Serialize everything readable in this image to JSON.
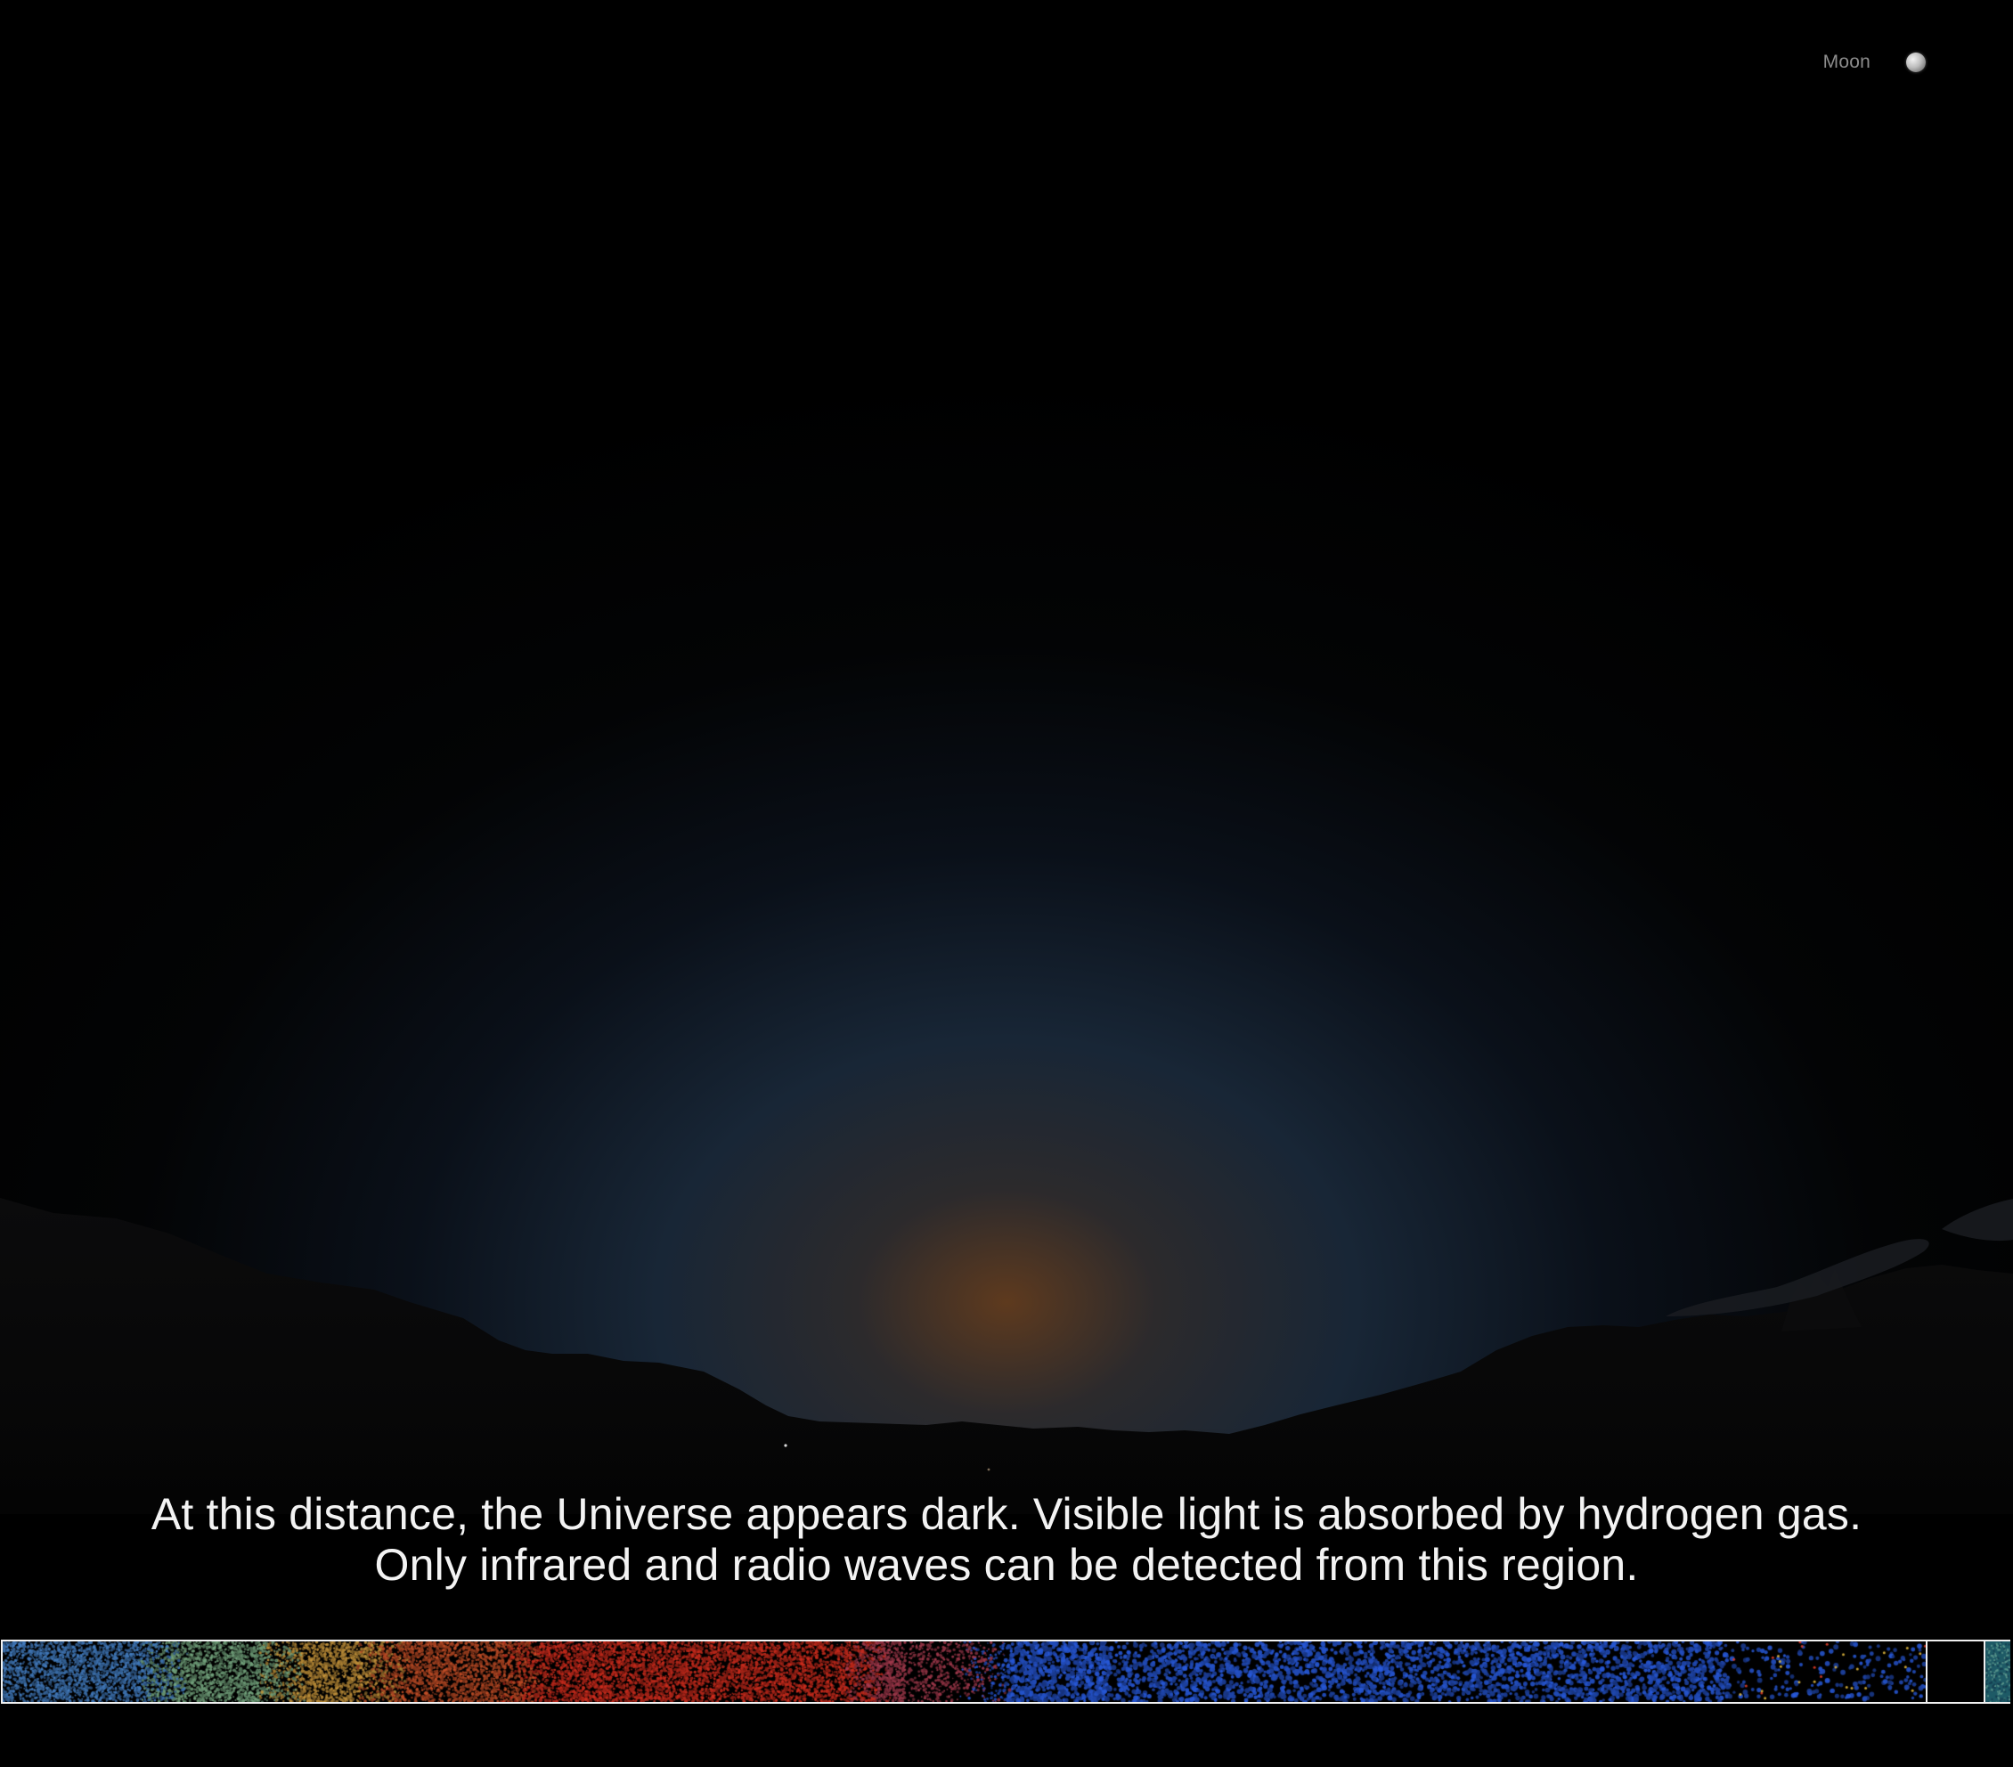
{
  "nav": {
    "target_label": "Moon",
    "target_icon": "moon-icon"
  },
  "caption": {
    "line1": "At this distance, the Universe appears dark. Visible light is absorbed by hydrogen gas.",
    "line2": "Only infrared and radio waves can be detected from this region."
  },
  "colors": {
    "background": "#000000",
    "caption_text": "#f3f3f3",
    "nav_text": "#8c8c8c",
    "timeline_border": "#f0f0f0",
    "horizon_glow": "#5a3a22",
    "sky_blue": "#1b2a3a"
  }
}
